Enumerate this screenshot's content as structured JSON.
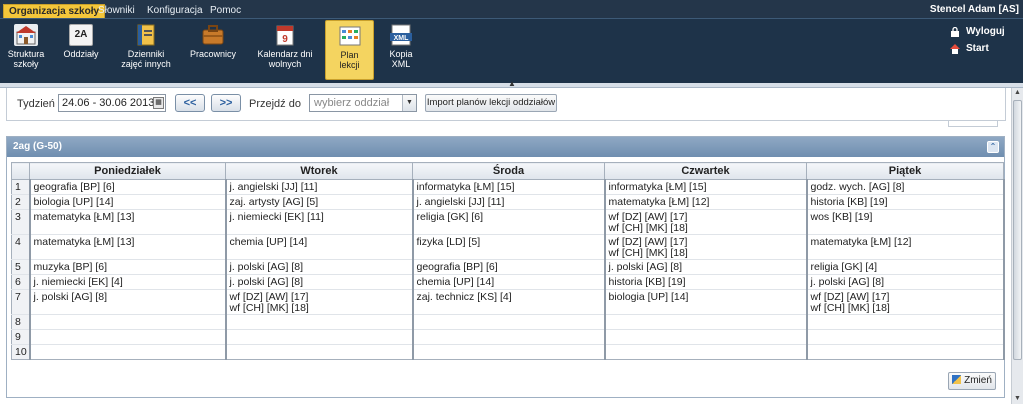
{
  "menu": {
    "tabs": [
      {
        "label": "Organizacja szkoły",
        "active": true
      },
      {
        "label": "Słowniki",
        "active": false
      },
      {
        "label": "Konfiguracja",
        "active": false
      },
      {
        "label": "Pomoc",
        "active": false
      }
    ],
    "user": "Stencel Adam [AS]"
  },
  "toolbar": {
    "buttons": [
      {
        "label": "Struktura\nszkoły",
        "icon": "school-structure-icon"
      },
      {
        "label": "Oddziały",
        "icon": "class-2a-icon"
      },
      {
        "label": "Dzienniki\nzajęć innych",
        "icon": "journal-icon"
      },
      {
        "label": "Pracownicy",
        "icon": "briefcase-icon"
      },
      {
        "label": "Kalendarz dni\nwolnych",
        "icon": "calendar-icon"
      },
      {
        "label": "Plan\nlekcji",
        "icon": "timetable-icon",
        "active": true
      },
      {
        "label": "Kopia\nXML",
        "icon": "xml-copy-icon"
      }
    ],
    "logout_label": "Wyloguj",
    "start_label": "Start"
  },
  "filter": {
    "week_label": "Tydzień",
    "week_value": "24.06 - 30.06 2013",
    "prev_label": "<<",
    "next_label": ">>",
    "goto_label": "Przejdź do",
    "goto_placeholder": "wybierz oddział",
    "import_label": "Import planów lekcji oddziałów"
  },
  "panel": {
    "title": "2ag (G-50)",
    "days": [
      "Poniedziałek",
      "Wtorek",
      "Środa",
      "Czwartek",
      "Piątek"
    ],
    "rows": [
      {
        "num": "1",
        "cells": [
          [
            "geografia [BP] [6]"
          ],
          [
            "j. angielski [JJ] [11]"
          ],
          [
            "informatyka [ŁM] [15]"
          ],
          [
            "informatyka [ŁM] [15]"
          ],
          [
            "godz. wych. [AG] [8]"
          ]
        ]
      },
      {
        "num": "2",
        "cells": [
          [
            "biologia [UP] [14]"
          ],
          [
            "zaj. artysty [AG] [5]"
          ],
          [
            "j. angielski [JJ] [11]"
          ],
          [
            "matematyka [ŁM] [12]"
          ],
          [
            "historia [KB] [19]"
          ]
        ]
      },
      {
        "num": "3",
        "cells": [
          [
            "matematyka [ŁM] [13]"
          ],
          [
            "j. niemiecki [EK] [11]"
          ],
          [
            "religia [GK] [6]"
          ],
          [
            "wf [DZ] [AW] [17]",
            "wf [CH] [MK] [18]"
          ],
          [
            "wos [KB] [19]"
          ]
        ]
      },
      {
        "num": "4",
        "cells": [
          [
            "matematyka [ŁM] [13]"
          ],
          [
            "chemia [UP] [14]"
          ],
          [
            "fizyka [LD] [5]"
          ],
          [
            "wf [DZ] [AW] [17]",
            "wf [CH] [MK] [18]"
          ],
          [
            "matematyka [ŁM] [12]"
          ]
        ]
      },
      {
        "num": "5",
        "cells": [
          [
            "muzyka [BP] [6]"
          ],
          [
            "j. polski [AG] [8]"
          ],
          [
            "geografia [BP] [6]"
          ],
          [
            "j. polski [AG] [8]"
          ],
          [
            "religia [GK] [4]"
          ]
        ]
      },
      {
        "num": "6",
        "cells": [
          [
            "j. niemiecki [EK] [4]"
          ],
          [
            "j. polski [AG] [8]"
          ],
          [
            "chemia [UP] [14]"
          ],
          [
            "historia [KB] [19]"
          ],
          [
            "j. polski [AG] [8]"
          ]
        ]
      },
      {
        "num": "7",
        "cells": [
          [
            "j. polski [AG] [8]"
          ],
          [
            "wf [DZ] [AW] [17]",
            "wf [CH] [MK] [18]"
          ],
          [
            "zaj. technicz [KS] [4]"
          ],
          [
            "biologia [UP] [14]"
          ],
          [
            "wf [DZ] [AW] [17]",
            "wf [CH] [MK] [18]"
          ]
        ]
      },
      {
        "num": "8",
        "cells": [
          [],
          [],
          [],
          [],
          []
        ]
      },
      {
        "num": "9",
        "cells": [
          [],
          [],
          [],
          [],
          []
        ]
      },
      {
        "num": "10",
        "cells": [
          [],
          [],
          [],
          [],
          []
        ]
      }
    ],
    "edit_label": "Zmień"
  }
}
